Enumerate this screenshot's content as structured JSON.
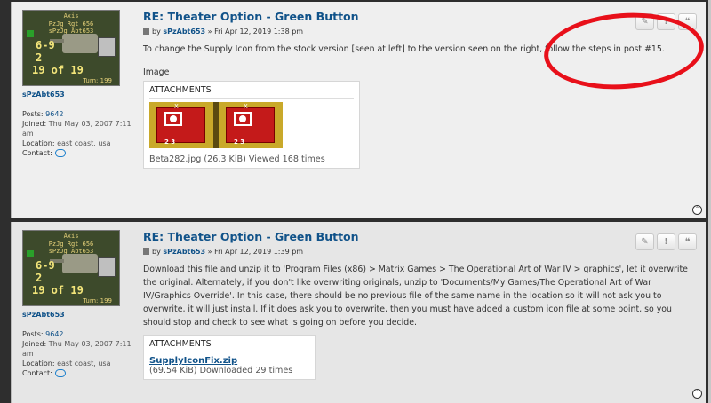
{
  "posts": [
    {
      "profile": {
        "avatar_lines": [
          "Axis",
          "PzJg Rgt 656",
          "sPzJg Abt653"
        ],
        "avatar_stats": [
          "6-9",
          "2",
          "19 of 19"
        ],
        "avatar_turn": "Turn: 199",
        "username": "sPzAbt653",
        "posts_label": "Posts:",
        "posts_value": "9642",
        "joined_label": "Joined:",
        "joined_value": "Thu May 03, 2007 7:11 am",
        "location_label": "Location:",
        "location_value": "east coast, usa",
        "contact_label": "Contact:"
      },
      "title": "RE: Theater Option - Green Button",
      "by": "by",
      "author": "sPzAbt653",
      "date": "» Fri Apr 12, 2019 1:38 pm",
      "text": "To change the Supply Icon from the stock version [seen at left] to the version seen on the right, follow the steps in post #15.",
      "image_label": "Image",
      "attachments_header": "ATTACHMENTS",
      "attachment_caption": "Beta282.jpg (26.3 KiB) Viewed 168 times",
      "tile_letters": [
        "X",
        "D"
      ],
      "tile_numbers": [
        "2 3",
        "2 3"
      ]
    },
    {
      "profile": {
        "avatar_lines": [
          "Axis",
          "PzJg Rgt 656",
          "sPzJg Abt653"
        ],
        "avatar_stats": [
          "6-9",
          "2",
          "19 of 19"
        ],
        "avatar_turn": "Turn: 199",
        "username": "sPzAbt653",
        "posts_label": "Posts:",
        "posts_value": "9642",
        "joined_label": "Joined:",
        "joined_value": "Thu May 03, 2007 7:11 am",
        "location_label": "Location:",
        "location_value": "east coast, usa",
        "contact_label": "Contact:"
      },
      "title": "RE: Theater Option - Green Button",
      "by": "by",
      "author": "sPzAbt653",
      "date": "» Fri Apr 12, 2019 1:39 pm",
      "text": "Download this file and unzip it to 'Program Files (x86) > Matrix Games > The Operational Art of War IV > graphics', let it overwrite the original. Alternately, if you don't like overwriting originals, unzip to 'Documents/My Games/The Operational Art of War IV/Graphics Override'. In this case, there should be no previous file of the same name in the location so it will not ask you to overwrite, it will just install. If it does ask you to overwrite, then you must have added a custom icon file at some point, so you should stop and check to see what is going on before you decide.",
      "attachments_header": "ATTACHMENTS",
      "file_link": "SupplyIconFix.zip",
      "attachment_caption": "(69.54 KiB) Downloaded 29 times"
    }
  ],
  "buttons": {
    "edit": "✎",
    "report": "!",
    "quote": "❝"
  },
  "icons": {
    "scroll_top": "⌃"
  },
  "colors": {
    "link": "#105289",
    "highlight_ring": "#e8101a"
  }
}
